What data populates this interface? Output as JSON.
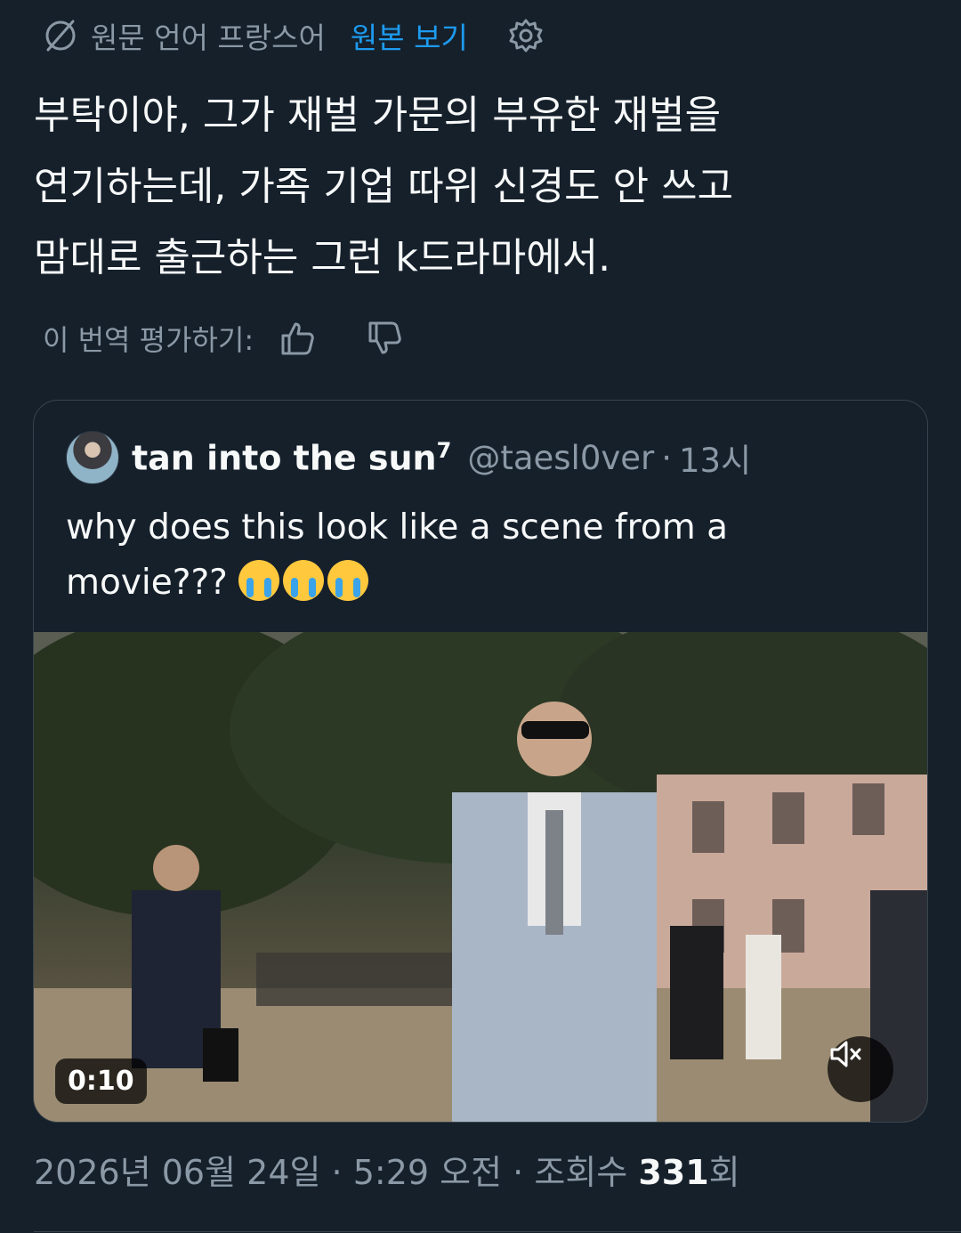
{
  "translation_bar": {
    "source_label": "원문 언어 프랑스어",
    "show_original_label": "원본 보기",
    "icons": [
      "globe-off-icon",
      "gear-icon"
    ]
  },
  "tweet": {
    "lines": [
      "부탁이야, 그가 재벌 가문의 부유한 재벌을",
      "연기하는데, 가족 기업 따위 신경도 안 쓰고",
      "맘대로 출근하는 그런 k드라마에서."
    ]
  },
  "rating": {
    "label": "이 번역 평가하기:",
    "icons": [
      "thumbs-up-icon",
      "thumbs-down-icon"
    ]
  },
  "quote": {
    "display_name": "tan into the sun",
    "display_name_sup": "7",
    "handle": "@taesl0ver",
    "separator": "·",
    "time": "13시",
    "text_line1": "why does this look like a scene from a",
    "text_line2": "movie???",
    "emoji_count": 3,
    "video": {
      "duration": "0:10",
      "icons": [
        "mute-icon"
      ]
    }
  },
  "meta": {
    "date": "2026년 06월 24일",
    "separator": "·",
    "time": "5:29 오전",
    "views_label": "조회수",
    "views_count": "331",
    "views_suffix": "회"
  },
  "colors": {
    "background": "#15202b",
    "accent": "#1d9bf0",
    "muted": "#8b98a5",
    "text": "#f7f9f9",
    "border": "#38444d"
  }
}
